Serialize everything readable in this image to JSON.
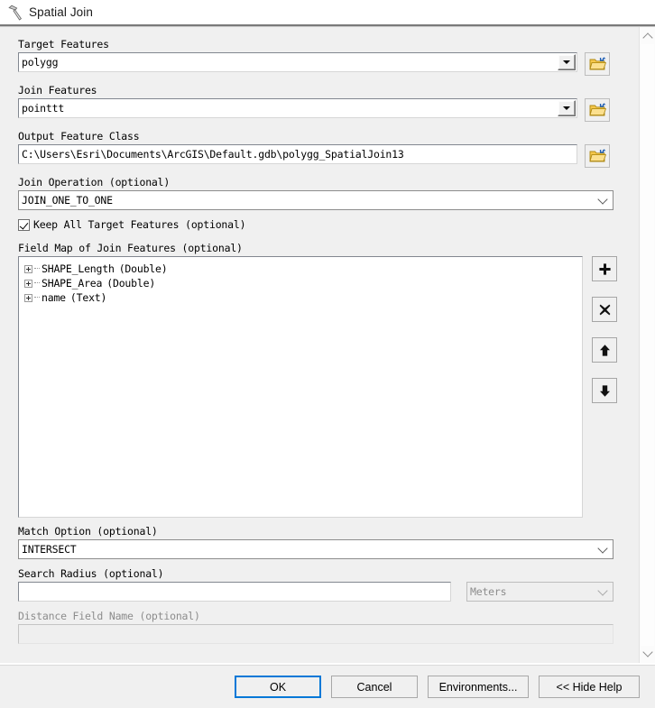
{
  "window": {
    "title": "Spatial Join",
    "icon": "hammer-tool-icon"
  },
  "form": {
    "target_features": {
      "label": "Target Features",
      "value": "polygg",
      "browse_icon": "folder-browse-icon",
      "dropdown_icon": "triangle-down-icon"
    },
    "join_features": {
      "label": "Join Features",
      "value": "pointtt",
      "browse_icon": "folder-browse-icon",
      "dropdown_icon": "triangle-down-icon"
    },
    "output_feature_class": {
      "label": "Output Feature Class",
      "value": "C:\\Users\\Esri\\Documents\\ArcGIS\\Default.gdb\\polygg_SpatialJoin13",
      "browse_icon": "folder-browse-icon"
    },
    "join_operation": {
      "label": "Join Operation (optional)",
      "value": "JOIN_ONE_TO_ONE",
      "dropdown_icon": "chevron-down-icon"
    },
    "keep_all_target_features": {
      "label": "Keep All Target Features (optional)",
      "checked": true
    },
    "field_map": {
      "label": "Field Map of Join Features (optional)",
      "items": [
        {
          "name": "SHAPE_Length",
          "type": "(Double)"
        },
        {
          "name": "SHAPE_Area",
          "type": "(Double)"
        },
        {
          "name": "name",
          "type": "(Text)"
        }
      ],
      "buttons": [
        {
          "name": "add-field-button",
          "icon": "plus-icon"
        },
        {
          "name": "delete-field-button",
          "icon": "cross-x-icon"
        },
        {
          "name": "move-up-button",
          "icon": "arrow-up-icon"
        },
        {
          "name": "move-down-button",
          "icon": "arrow-down-icon"
        }
      ]
    },
    "match_option": {
      "label": "Match Option (optional)",
      "value": "INTERSECT",
      "dropdown_icon": "chevron-down-icon"
    },
    "search_radius": {
      "label": "Search Radius (optional)",
      "value": "",
      "units_value": "Meters",
      "units_disabled": true,
      "dropdown_icon": "chevron-down-icon"
    },
    "distance_field_name": {
      "label": "Distance Field Name (optional)",
      "value": "",
      "disabled": true
    }
  },
  "scrollbar": {
    "up_icon": "chevron-up-icon",
    "down_icon": "chevron-down-icon"
  },
  "footer": {
    "ok": "OK",
    "cancel": "Cancel",
    "environments": "Environments...",
    "hide_help": "<< Hide Help"
  },
  "colors": {
    "panel_bg": "#f0f0f0",
    "focus_blue": "#0078d7",
    "folder_yellow": "#f5c74b",
    "arrow_blue": "#1f5fb4"
  }
}
